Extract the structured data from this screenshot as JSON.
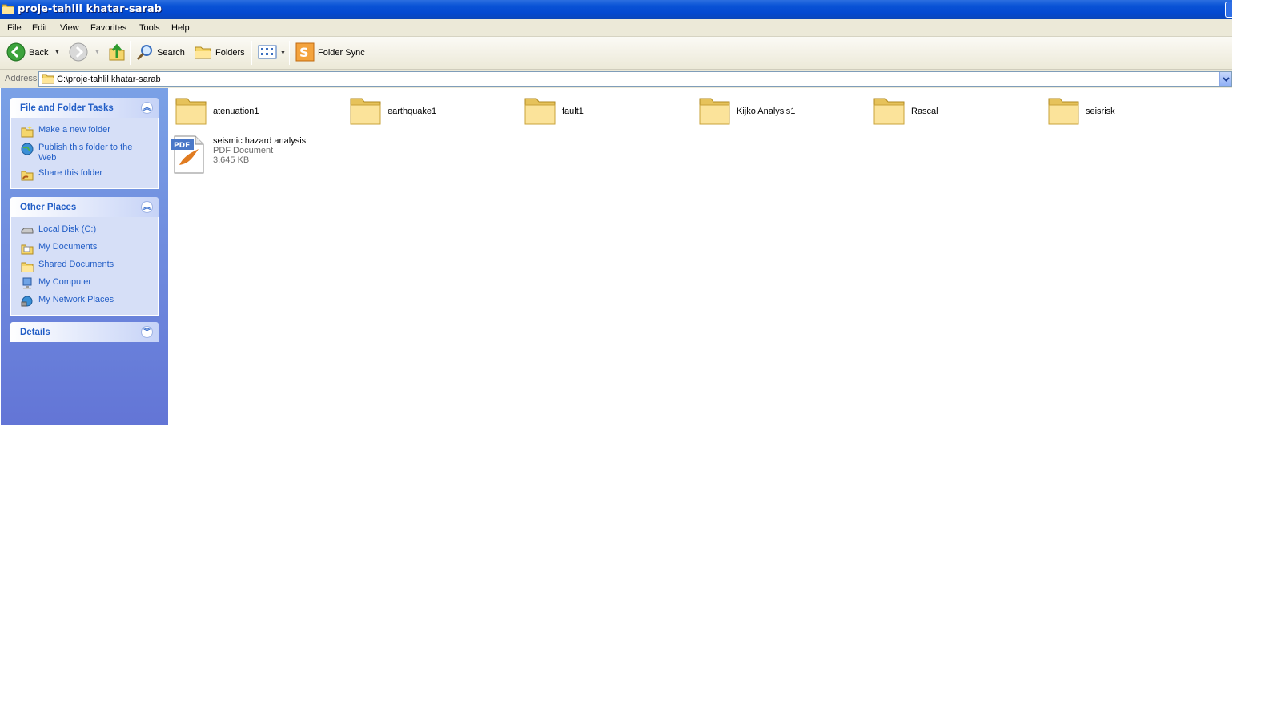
{
  "window": {
    "title": "proje-tahlil khatar-sarab"
  },
  "menu": [
    "File",
    "Edit",
    "View",
    "Favorites",
    "Tools",
    "Help"
  ],
  "toolbar": {
    "back_label": "Back",
    "search_label": "Search",
    "folders_label": "Folders",
    "folder_sync_label": "Folder Sync"
  },
  "address": {
    "label": "Address",
    "value": "C:\\proje-tahlil khatar-sarab"
  },
  "tasks_panel": {
    "title": "File and Folder Tasks",
    "items": [
      {
        "label": "Make a new folder",
        "icon": "new-folder-icon"
      },
      {
        "label": "Publish this folder to the Web",
        "icon": "publish-web-icon"
      },
      {
        "label": "Share this folder",
        "icon": "share-folder-icon"
      }
    ]
  },
  "places_panel": {
    "title": "Other Places",
    "items": [
      {
        "label": "Local Disk (C:)",
        "icon": "local-disk-icon"
      },
      {
        "label": "My Documents",
        "icon": "my-documents-icon"
      },
      {
        "label": "Shared Documents",
        "icon": "shared-documents-icon"
      },
      {
        "label": "My Computer",
        "icon": "my-computer-icon"
      },
      {
        "label": "My Network Places",
        "icon": "network-places-icon"
      }
    ]
  },
  "details_panel": {
    "title": "Details"
  },
  "files": [
    {
      "name": "atenuation1",
      "type": "folder"
    },
    {
      "name": "earthquake1",
      "type": "folder"
    },
    {
      "name": "fault1",
      "type": "folder"
    },
    {
      "name": "Kijko Analysis1",
      "type": "folder"
    },
    {
      "name": "Rascal",
      "type": "folder"
    },
    {
      "name": "seisrisk",
      "type": "folder"
    },
    {
      "name": "seismic hazard analysis",
      "type": "pdf",
      "kind": "PDF Document",
      "size": "3,645 KB"
    }
  ],
  "colors": {
    "titlebar": "#0349d0",
    "taskpane": "#7aa1e6",
    "link": "#215dc6",
    "folder": "#f5d66b"
  }
}
